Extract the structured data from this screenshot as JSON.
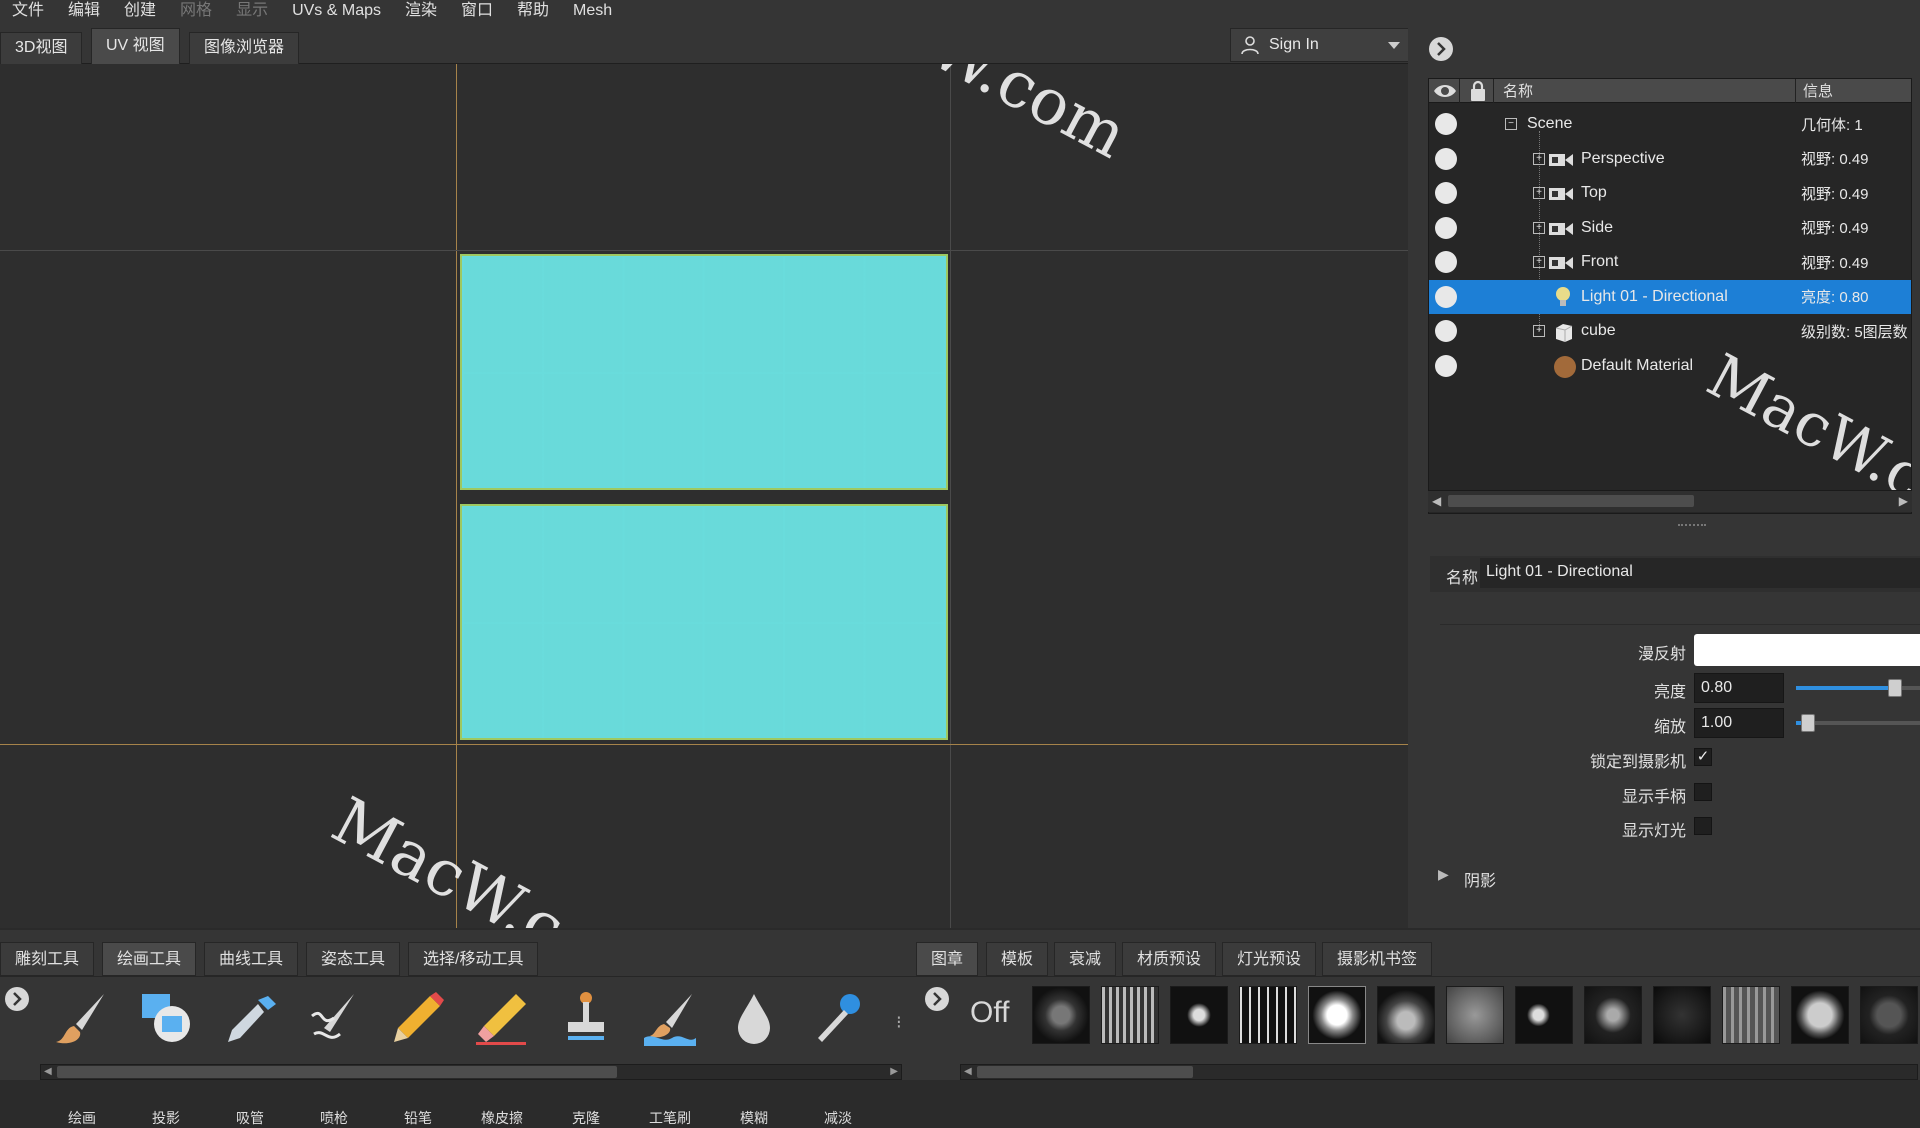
{
  "menubar": {
    "items": [
      {
        "label": "文件",
        "enabled": true
      },
      {
        "label": "编辑",
        "enabled": true
      },
      {
        "label": "创建",
        "enabled": true
      },
      {
        "label": "网格",
        "enabled": false
      },
      {
        "label": "显示",
        "enabled": false
      },
      {
        "label": "UVs & Maps",
        "enabled": true
      },
      {
        "label": "渲染",
        "enabled": true
      },
      {
        "label": "窗口",
        "enabled": true
      },
      {
        "label": "帮助",
        "enabled": true
      },
      {
        "label": "Mesh",
        "enabled": true
      }
    ]
  },
  "view_tabs": [
    {
      "label": "3D视图"
    },
    {
      "label": "UV 视图",
      "active": true
    },
    {
      "label": "图像浏览器"
    }
  ],
  "account": {
    "sign_in": "Sign In"
  },
  "watermark": "MacW.com",
  "outliner": {
    "header": {
      "name": "名称",
      "info": "信息"
    },
    "rows": [
      {
        "label": "Scene",
        "info": "几何体: 1",
        "icon": "scene-icon"
      },
      {
        "label": "Perspective",
        "info": "视野: 0.49",
        "icon": "camera-icon"
      },
      {
        "label": "Top",
        "info": "视野: 0.49",
        "icon": "camera-icon"
      },
      {
        "label": "Side",
        "info": "视野: 0.49",
        "icon": "camera-icon"
      },
      {
        "label": "Front",
        "info": "视野: 0.49",
        "icon": "camera-icon"
      },
      {
        "label": "Light 01 - Directional",
        "info": "亮度: 0.80",
        "icon": "lightbulb-icon",
        "selected": true
      },
      {
        "label": "cube",
        "info": "级别数: 5图层数",
        "icon": "cube-icon"
      },
      {
        "label": "Default Material",
        "info": "",
        "icon": "material-sphere-icon"
      }
    ]
  },
  "properties": {
    "name_label": "名称",
    "name_value": "Light 01 - Directional",
    "diffuse_label": "漫反射",
    "diffuse_color": "#ffffff",
    "brightness_label": "亮度",
    "brightness_value": "0.80",
    "brightness_level": 0.8,
    "scale_label": "缩放",
    "scale_value": "1.00",
    "scale_level": 0.1,
    "lock_label": "锁定到摄影机",
    "lock_checked": "✓",
    "handles_label": "显示手柄",
    "show_light_label": "显示灯光",
    "shadow_label": "阴影"
  },
  "tool_tabs": [
    {
      "label": "雕刻工具"
    },
    {
      "label": "绘画工具",
      "active": true
    },
    {
      "label": "曲线工具"
    },
    {
      "label": "姿态工具"
    },
    {
      "label": "选择/移动工具"
    }
  ],
  "paint_tools": [
    {
      "label": "绘画",
      "icon": "paint-brush-icon"
    },
    {
      "label": "投影",
      "icon": "projection-icon"
    },
    {
      "label": "吸管",
      "icon": "eyedropper-icon"
    },
    {
      "label": "喷枪",
      "icon": "airbrush-icon"
    },
    {
      "label": "铅笔",
      "icon": "pencil-icon"
    },
    {
      "label": "橡皮擦",
      "icon": "eraser-icon"
    },
    {
      "label": "克隆",
      "icon": "clone-stamp-icon"
    },
    {
      "label": "工笔刷",
      "icon": "fill-brush-icon"
    },
    {
      "label": "模糊",
      "icon": "blur-drop-icon"
    },
    {
      "label": "减淡",
      "icon": "dodge-icon"
    }
  ],
  "library_tabs": [
    {
      "label": "图章",
      "active": true
    },
    {
      "label": "模板"
    },
    {
      "label": "衰减"
    },
    {
      "label": "材质预设"
    },
    {
      "label": "灯光预设"
    },
    {
      "label": "摄影机书签"
    }
  ],
  "stamps": {
    "off_label": "Off",
    "count": 13
  },
  "colors": {
    "accent": "#1d7fd6",
    "uv_edge": "#9ec860",
    "uv_grid": "#69dcdc",
    "guide": "#b08a4a"
  }
}
